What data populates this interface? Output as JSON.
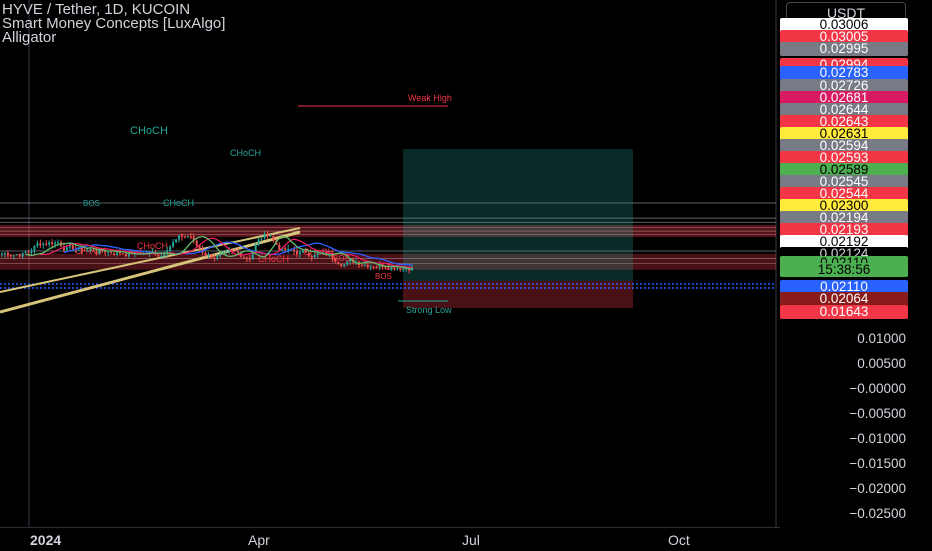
{
  "header": {
    "symbol_line": "HYVE / Tether, 1D, KUCOIN",
    "indicator_1": "Smart Money Concepts [LuxAlgo]",
    "indicator_2": "Alligator"
  },
  "currency_button": "USDT",
  "countdown": "15:38:56",
  "price_tags": [
    {
      "text": "0.03006",
      "bg": "#ffffff",
      "fg": "#000000"
    },
    {
      "text": "0.03005",
      "bg": "#f23645",
      "fg": "#ffffff"
    },
    {
      "text": "0.02995",
      "bg": "#787b86",
      "fg": "#ffffff"
    },
    {
      "text": "0.02994",
      "bg": "#f23645",
      "fg": "#ffffff"
    },
    {
      "text": "0.02783",
      "bg": "#2962ff",
      "fg": "#ffffff"
    },
    {
      "text": "0.02726",
      "bg": "#787b86",
      "fg": "#ffffff"
    },
    {
      "text": "0.02681",
      "bg": "#d81b60",
      "fg": "#ffffff"
    },
    {
      "text": "0.02644",
      "bg": "#787b86",
      "fg": "#ffffff"
    },
    {
      "text": "0.02643",
      "bg": "#f23645",
      "fg": "#ffffff"
    },
    {
      "text": "0.02631",
      "bg": "#ffeb3b",
      "fg": "#000000"
    },
    {
      "text": "0.02594",
      "bg": "#787b86",
      "fg": "#ffffff"
    },
    {
      "text": "0.02593",
      "bg": "#f23645",
      "fg": "#ffffff"
    },
    {
      "text": "0.02589",
      "bg": "#4caf50",
      "fg": "#000000"
    },
    {
      "text": "0.02545",
      "bg": "#787b86",
      "fg": "#ffffff"
    },
    {
      "text": "0.02544",
      "bg": "#f23645",
      "fg": "#ffffff"
    },
    {
      "text": "0.02300",
      "bg": "#ffeb3b",
      "fg": "#000000"
    },
    {
      "text": "0.02194",
      "bg": "#787b86",
      "fg": "#ffffff"
    },
    {
      "text": "0.02193",
      "bg": "#f23645",
      "fg": "#ffffff"
    },
    {
      "text": "0.02192",
      "bg": "#ffffff",
      "fg": "#000000"
    },
    {
      "text": "0.02124",
      "bg": "#000000",
      "fg": "#d1d4dc"
    },
    {
      "text": "0.02110",
      "bg": "#4caf50",
      "fg": "#000000"
    },
    {
      "text": "0.02110",
      "bg": "#2962ff",
      "fg": "#ffffff"
    },
    {
      "text": "0.02064",
      "bg": "#8b1a1a",
      "fg": "#ffffff"
    },
    {
      "text": "0.01643",
      "bg": "#f23645",
      "fg": "#ffffff"
    }
  ],
  "chart_data": {
    "type": "candlestick",
    "title": "HYVE / Tether, 1D, KUCOIN",
    "y_axis_ticks": [
      "0.01000",
      "0.00500",
      "−0.00000",
      "−0.00500",
      "−0.01000",
      "−0.01500",
      "−0.02000",
      "−0.02500"
    ],
    "x_axis_ticks": [
      {
        "label": "2024",
        "bold": true
      },
      {
        "label": "Apr",
        "bold": false
      },
      {
        "label": "Jul",
        "bold": false
      },
      {
        "label": "Oct",
        "bold": false
      }
    ],
    "last_price": 0.0211,
    "annotations": [
      "Weak High",
      "Strong Low",
      "CHoCH",
      "BOS"
    ],
    "colors": {
      "up": "#26a69a",
      "down": "#ef5350",
      "alligator_jaw": "#2962ff",
      "alligator_teeth": "#e91e63",
      "alligator_lips": "#66bb6a"
    },
    "grid": false
  }
}
